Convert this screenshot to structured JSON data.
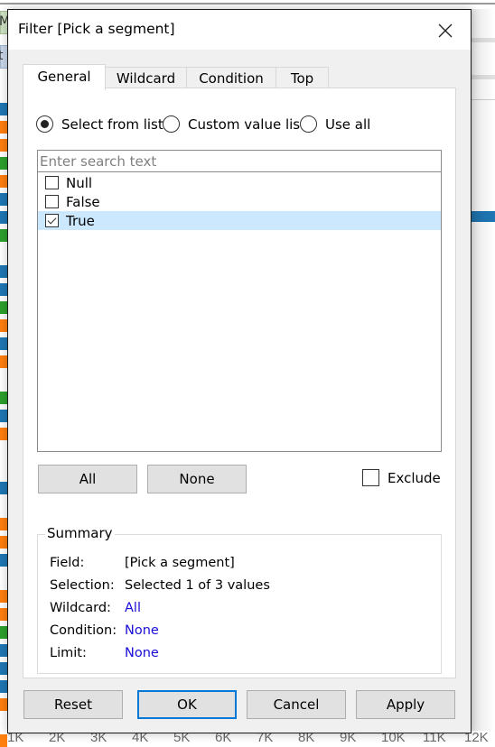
{
  "background": {
    "pill_green_text": "M",
    "pill_blue_text": "t",
    "bar_colors": [
      "#1f77b4",
      "#ff7f0e",
      "#2ca02c"
    ],
    "left_bars": [
      "blue",
      "orange",
      "orange",
      "green",
      "orange",
      "blue",
      "blue",
      "green",
      "",
      "blue",
      "blue",
      "green",
      "orange",
      "blue",
      "orange",
      "",
      "green",
      "blue",
      "orange",
      "",
      "",
      "blue",
      "",
      "orange",
      "orange",
      "blue",
      "",
      "orange",
      "orange",
      "green",
      "blue",
      "blue",
      "blue",
      "orange",
      "",
      "orange"
    ],
    "axis_ticks": [
      "1K",
      "2K",
      "3K",
      "4K",
      "5K",
      "6K",
      "7K",
      "8K",
      "9K",
      "10K",
      "11K",
      "12K"
    ]
  },
  "dialog": {
    "title": "Filter [Pick a segment]",
    "close_icon": "close-icon",
    "tabs": [
      {
        "label": "General",
        "active": true
      },
      {
        "label": "Wildcard",
        "active": false
      },
      {
        "label": "Condition",
        "active": false
      },
      {
        "label": "Top",
        "active": false
      }
    ],
    "mode_options": [
      {
        "label": "Select from list",
        "selected": true
      },
      {
        "label": "Custom value list",
        "selected": false
      },
      {
        "label": "Use all",
        "selected": false
      }
    ],
    "search": {
      "value": "",
      "placeholder": "Enter search text"
    },
    "values": [
      {
        "label": "Null",
        "checked": false,
        "highlighted": false
      },
      {
        "label": "False",
        "checked": false,
        "highlighted": false
      },
      {
        "label": "True",
        "checked": true,
        "highlighted": true
      }
    ],
    "all_button": "All",
    "none_button": "None",
    "exclude": {
      "label": "Exclude",
      "checked": false
    },
    "summary": {
      "title": "Summary",
      "rows": [
        {
          "key": "Field:",
          "value": "[Pick a segment]",
          "link": false
        },
        {
          "key": "Selection:",
          "value": "Selected 1 of 3 values",
          "link": false
        },
        {
          "key": "Wildcard:",
          "value": "All",
          "link": true
        },
        {
          "key": "Condition:",
          "value": "None",
          "link": true
        },
        {
          "key": "Limit:",
          "value": "None",
          "link": true
        }
      ]
    },
    "footer": {
      "reset": "Reset",
      "ok": "OK",
      "cancel": "Cancel",
      "apply": "Apply"
    },
    "colors": {
      "accent": "#0078d7",
      "selection": "#cce8ff",
      "link": "#1a0dd8"
    }
  }
}
